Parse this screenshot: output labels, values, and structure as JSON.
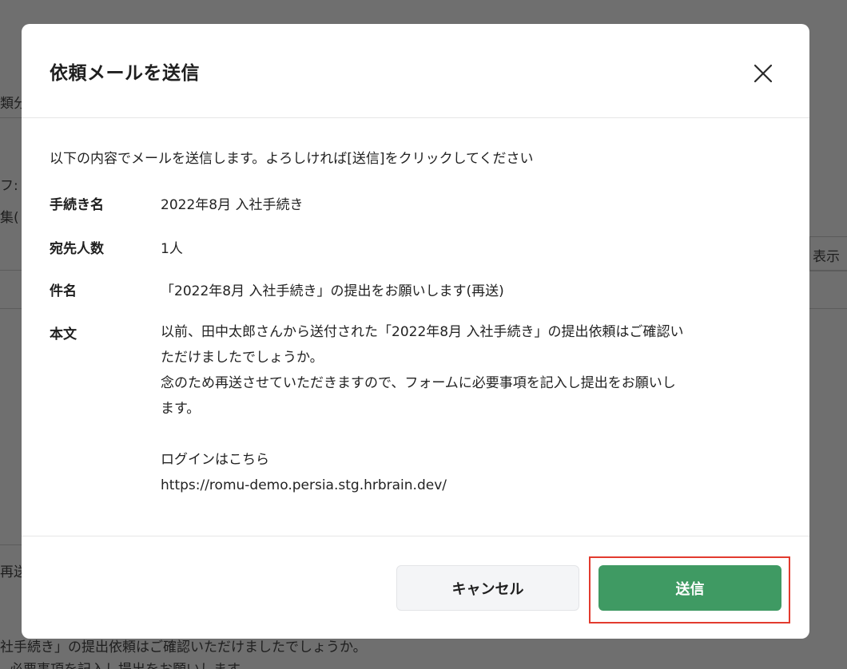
{
  "background": {
    "fragments": [
      "類分",
      "フ:",
      "集(",
      "表示",
      "再送",
      "社手続き」の提出依頼はご確認いただけましたでしょうか。",
      "必要事項を記入し提出をお願いします"
    ]
  },
  "modal": {
    "title": "依頼メールを送信",
    "close_icon": "close-icon",
    "intro": "以下の内容でメールを送信します。よろしければ[送信]をクリックしてください",
    "fields": [
      {
        "label": "手続き名",
        "value": "2022年8月 入社手続き"
      },
      {
        "label": "宛先人数",
        "value": "1人"
      },
      {
        "label": "件名",
        "value": "「2022年8月 入社手続き」の提出をお願いします(再送)"
      },
      {
        "label": "本文"
      }
    ],
    "body_lines": [
      "以前、田中太郎さんから送付された「2022年8月 入社手続き」の提出依頼はご確認い",
      "ただけましたでしょうか。",
      "念のため再送させていただきますので、フォームに必要事項を記入し提出をお願いし",
      "ます。",
      "",
      "ログインはこちら",
      "https://romu-demo.persia.stg.hrbrain.dev/"
    ],
    "cancel_label": "キャンセル",
    "send_label": "送信"
  },
  "colors": {
    "overlay": "#6f6f6f",
    "primary_button": "#3f9a63",
    "highlight": "#e23b2e"
  }
}
